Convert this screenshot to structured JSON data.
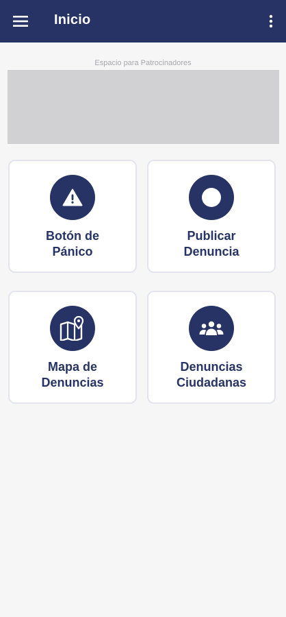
{
  "appbar": {
    "title": "Inicio",
    "menu_icon": "hamburger-menu-icon",
    "more_icon": "more-vertical-icon"
  },
  "sponsor": {
    "label": "Espacio para Patrocinadores"
  },
  "cards": [
    {
      "label": "Botón de\nPánico",
      "icon": "warning-icon"
    },
    {
      "label": "Publicar\nDenuncia",
      "icon": "record-circle-icon"
    },
    {
      "label": "Mapa de\nDenuncias",
      "icon": "map-pin-icon"
    },
    {
      "label": "Denuncias\nCiudadanas",
      "icon": "group-people-icon"
    }
  ],
  "colors": {
    "primary": "#263364",
    "background": "#f6f6f7",
    "sponsor_box": "#d1d1d3",
    "card_border": "#e3e4ee"
  }
}
